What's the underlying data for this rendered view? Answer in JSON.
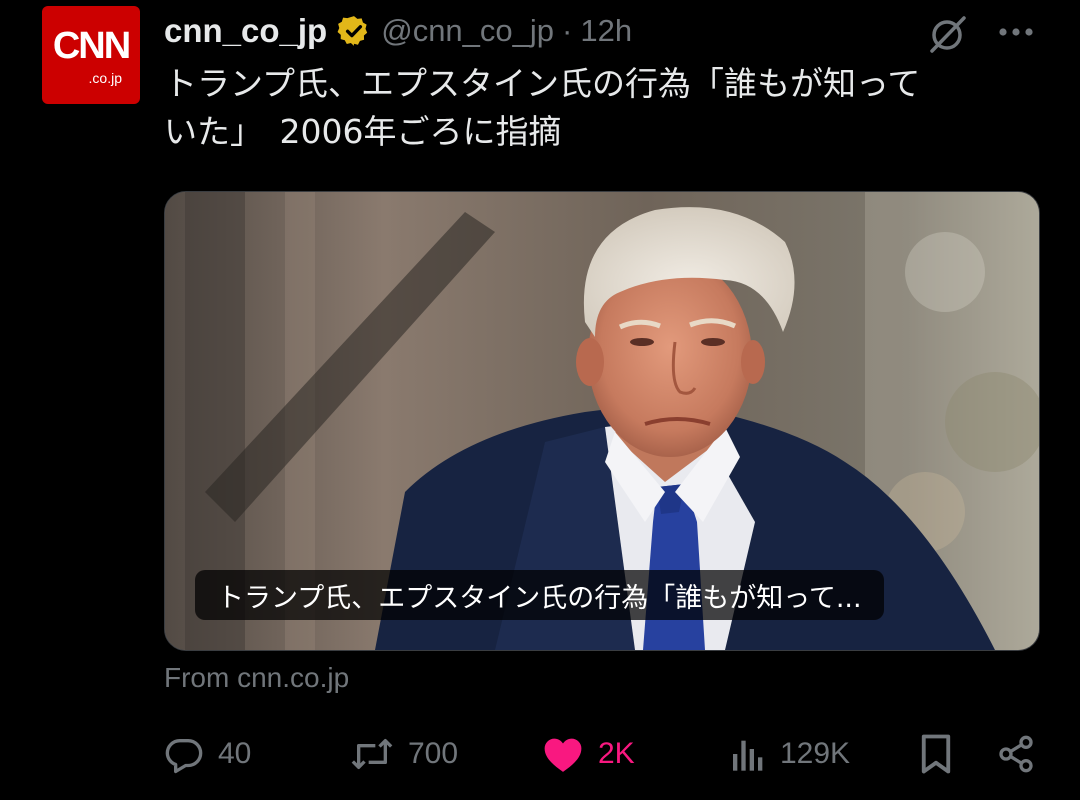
{
  "avatar": {
    "logo_text": "CNN",
    "sub_text": ".co.jp",
    "color": "#cc0000"
  },
  "header": {
    "display_name": "cnn_co_jp",
    "verified": true,
    "verified_color": "#e2b719",
    "handle": "@cnn_co_jp",
    "separator": "·",
    "time": "12h",
    "grok_icon": "grok-icon",
    "more_icon": "more-icon"
  },
  "tweet": {
    "text": "トランプ氏、エプスタイン氏の行為「誰もが知って\nいた」　2006年ごろに指摘"
  },
  "media": {
    "caption": "トランプ氏、エプスタイン氏の行為「誰もが知って..."
  },
  "link_source": "From cnn.co.jp",
  "actions": {
    "reply": {
      "icon": "reply-icon",
      "count": "40"
    },
    "retweet": {
      "icon": "retweet-icon",
      "count": "700"
    },
    "like": {
      "icon": "heart-icon",
      "count": "2K",
      "liked": true,
      "color": "#f91880"
    },
    "views": {
      "icon": "views-icon",
      "count": "129K"
    },
    "bookmark": {
      "icon": "bookmark-icon"
    },
    "share": {
      "icon": "share-icon"
    }
  },
  "colors": {
    "background": "#000000",
    "text_primary": "#e7e9ea",
    "text_secondary": "#71767b",
    "like": "#f91880"
  }
}
